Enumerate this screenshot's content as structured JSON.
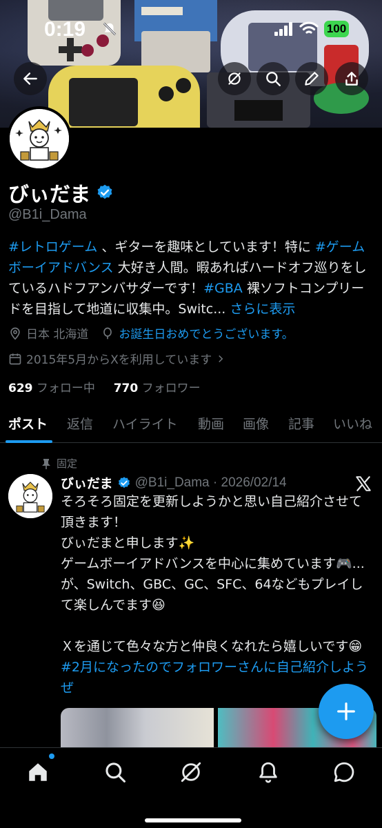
{
  "status_bar": {
    "time": "0:19",
    "battery": "100"
  },
  "banner": {
    "back_icon": "arrow-left-icon",
    "grok_icon": "grok-icon",
    "search_icon": "search-icon",
    "edit_icon": "pencil-icon",
    "share_icon": "share-icon"
  },
  "profile": {
    "name": "びぃだま",
    "handle": "@B1i_Dama",
    "bio": {
      "tag1": "#レトロゲーム",
      "text1": " 、ギターを趣味としています！特に ",
      "tag2": "#ゲームボーイアドバンス",
      "text2": " 大好き人間。暇あればハードオフ巡りをしているハドフアンバサダーです！",
      "tag3": "#GBA",
      "text3": " 裸ソフトコンプリードを目指して地道に収集中。Switc... ",
      "more": "さらに表示"
    },
    "location": "日本 北海道",
    "birthday": "お誕生日おめでとうございます。",
    "joined": "2015年5月からXを利用しています",
    "following_count": "629",
    "following_label": " フォロー中",
    "followers_count": "770",
    "followers_label": " フォロワー"
  },
  "tabs": [
    "ポスト",
    "返信",
    "ハイライト",
    "動画",
    "画像",
    "記事",
    "いいね"
  ],
  "post": {
    "pinned_label": "固定",
    "author_name": "びぃだま",
    "author_handle_date": "@B1i_Dama · 2026/02/14",
    "lines": [
      "そろそろ固定を更新しようかと思い自己紹介させて頂きます！",
      "びぃだまと申します✨",
      "ゲームボーイアドバンスを中心に集めています🎮...が、Switch、GBC、GC、SFC、64などもプレイして楽しんでます😆"
    ],
    "line4": "Ｘを通じて色々な方と仲良くなれたら嬉しいです😁",
    "hashtag": "#2月になったのでフォロワーさんに自己紹介しようぜ"
  },
  "bottom_nav": {
    "items": [
      "home-icon",
      "search-icon",
      "grok-icon",
      "bell-icon",
      "messages-icon"
    ]
  },
  "colors": {
    "accent": "#1d9bf0",
    "background": "#000000",
    "text": "#e7e9ea",
    "muted": "#71767b",
    "battery": "#3dd64f"
  }
}
